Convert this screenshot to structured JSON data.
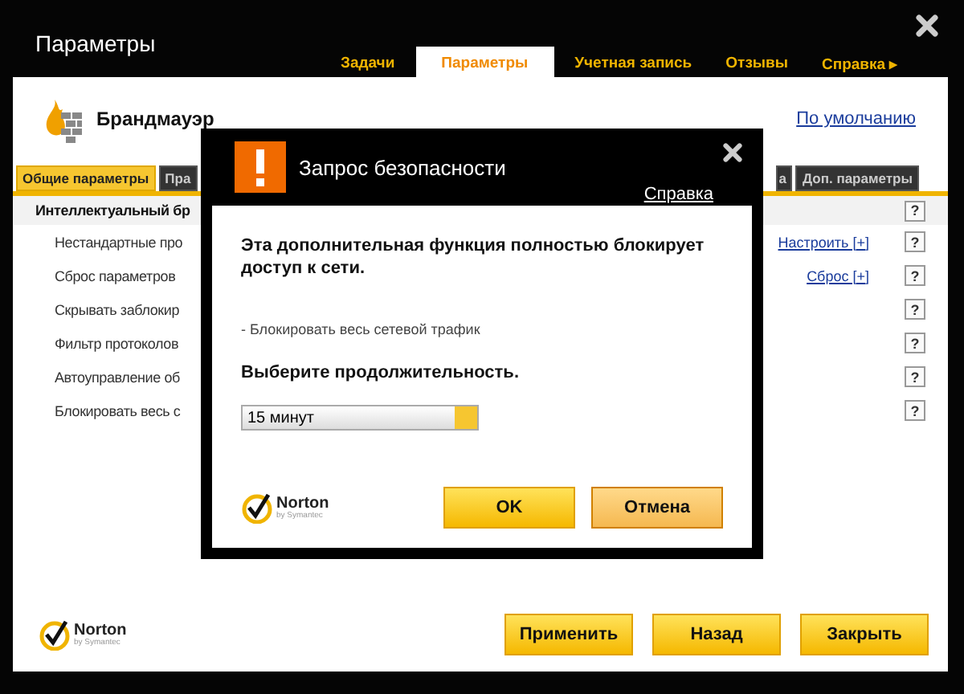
{
  "window": {
    "title": "Параметры"
  },
  "nav_tabs": [
    {
      "label": "Задачи",
      "selected": false
    },
    {
      "label": "Параметры",
      "selected": true
    },
    {
      "label": "Учетная запись",
      "selected": false
    },
    {
      "label": "Отзывы",
      "selected": false
    },
    {
      "label": "Справка ▸",
      "selected": false
    }
  ],
  "section": {
    "title": "Брандмауэр",
    "default_link": "По умолчанию"
  },
  "sub_tabs": [
    {
      "label": "Общие параметры",
      "selected": true
    },
    {
      "label": "Пра",
      "selected": false
    },
    {
      "label": "а",
      "selected": false
    },
    {
      "label": "Доп. параметры",
      "selected": false
    }
  ],
  "settings": [
    {
      "kind": "group",
      "label": "Интеллектуальный бр",
      "help": "?"
    },
    {
      "kind": "option",
      "label": "Нестандартные про",
      "link": "Настроить [+]",
      "help": "?"
    },
    {
      "kind": "option",
      "label": "Сброс параметров",
      "link": "Сброс [+]",
      "help": "?"
    },
    {
      "kind": "option",
      "label": "Скрывать заблокир",
      "help": "?"
    },
    {
      "kind": "option",
      "label": "Фильтр протоколов",
      "help": "?"
    },
    {
      "kind": "option",
      "label": "Автоуправление об",
      "help": "?"
    },
    {
      "kind": "option",
      "label": "Блокировать весь с",
      "help": "?"
    }
  ],
  "footer": {
    "logo": {
      "name": "Norton",
      "tagline": "by Symantec"
    },
    "buttons": [
      "Применить",
      "Назад",
      "Закрыть"
    ]
  },
  "dialog": {
    "title": "Запрос безопасности",
    "help_link": "Справка",
    "message": "Эта дополнительная функция полностью блокирует доступ к сети.",
    "detail": "- Блокировать весь сетевой трафик",
    "prompt": "Выберите продолжительность.",
    "duration": {
      "value": "15 минут"
    },
    "logo": {
      "name": "Norton",
      "tagline": "by Symantec"
    },
    "buttons": [
      "OK",
      "Отмена"
    ]
  }
}
